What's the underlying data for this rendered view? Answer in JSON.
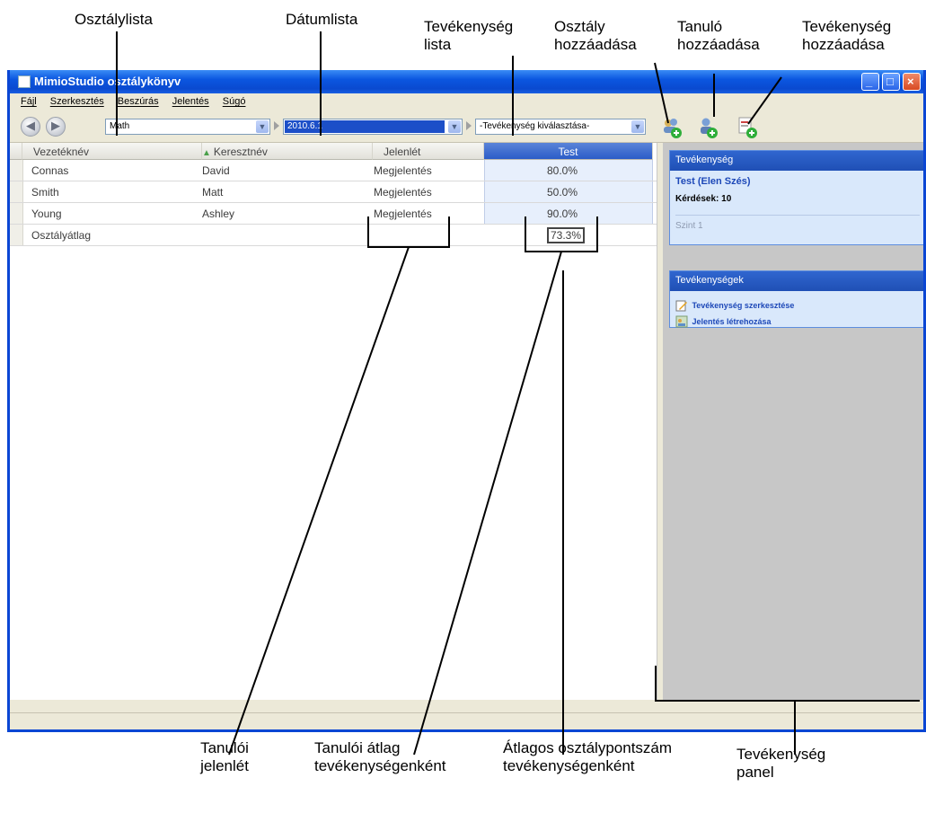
{
  "callouts": {
    "class_list": "Osztálylista",
    "date_list": "Dátumlista",
    "activity_list": "Tevékenység\nlista",
    "add_class": "Osztály\nhozzáadása",
    "add_student": "Tanuló\nhozzáadása",
    "add_activity": "Tevékenység\nhozzáadása",
    "student_attendance": "Tanulói\njelenlét",
    "student_average": "Tanulói átlag\ntevékenységenként",
    "class_average": "Átlagos osztálypontszám\ntevékenységenként",
    "activity_panel": "Tevékenység\npanel"
  },
  "window": {
    "title": "MimioStudio osztálykönyv",
    "menu": [
      "Fájl",
      "Szerkesztés",
      "Beszúrás",
      "Jelentés",
      "Súgó"
    ]
  },
  "toolbar": {
    "class_value": "Math",
    "date_value": "2010.6.1",
    "activity_placeholder": "-Tevékenység kiválasztása-"
  },
  "grid": {
    "columns": [
      "Vezetéknév",
      "Keresztnév",
      "Jelenlét",
      "Test"
    ],
    "sort_column": "Keresztnév",
    "rows": [
      [
        "Connas",
        "David",
        "Megjelentés",
        "80.0%"
      ],
      [
        "Smith",
        "Matt",
        "Megjelentés",
        "50.0%"
      ],
      [
        "Young",
        "Ashley",
        "Megjelentés",
        "90.0%"
      ]
    ],
    "summary_label": "Osztályátlag",
    "summary_value": "73.3%"
  },
  "panel": {
    "activity": {
      "header": "Tevékenység",
      "name": "Test (Elen Szés)",
      "questions": "Kérdések: 10",
      "level": "Szint 1"
    },
    "activities": {
      "header": "Tevékenységek",
      "edit": "Tevékenység szerkesztése",
      "report": "Jelentés létrehozása"
    }
  }
}
